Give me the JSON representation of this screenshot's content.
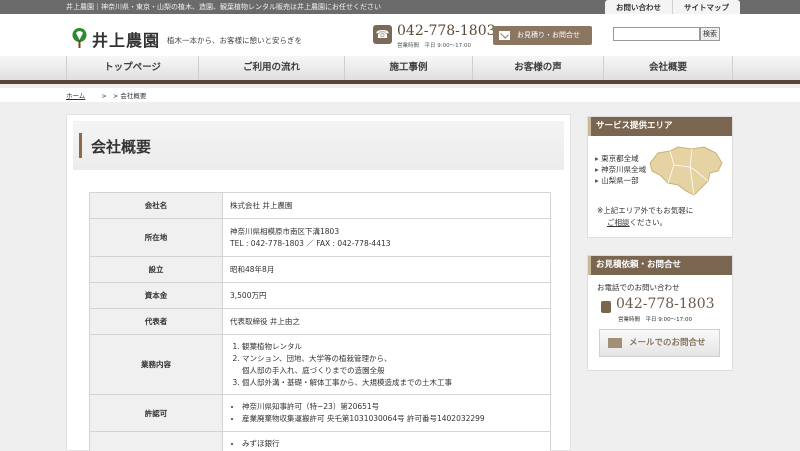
{
  "top_bar": {
    "tagline": "井上農園｜神奈川県・東京・山梨の植木、造園、観葉植物レンタル販売は井上農園にお任せください",
    "links": [
      "お問い合わせ",
      "サイトマップ"
    ]
  },
  "header": {
    "logo_text": "井上農園",
    "catchphrase": "植木一本から、お客様に憩いと安らぎを",
    "phone_icon": "phone-icon",
    "phone": "042-778-1803",
    "hours": "営業時間　平日 9:00～17:00",
    "mail_button": "お見積り・お問合せ",
    "search_placeholder": "",
    "search_button": "検索"
  },
  "nav": {
    "items": [
      "トップページ",
      "ご利用の流れ",
      "施工事例",
      "お客様の声",
      "会社概要"
    ]
  },
  "breadcrumb": {
    "home": "ホーム",
    "separator": ">",
    "current": "> 会社概要"
  },
  "main": {
    "title": "会社概要",
    "rows": [
      {
        "label": "会社名",
        "value": "株式会社 井上農園"
      },
      {
        "label": "所在地",
        "line1": "神奈川県相模原市南区下溝1803",
        "line2": "TEL : 042-778-1803 ／ FAX : 042-778-4413"
      },
      {
        "label": "設立",
        "value": "昭和48年8月"
      },
      {
        "label": "資本金",
        "value": "3,500万円"
      },
      {
        "label": "代表者",
        "value": "代表取締役 井上由之"
      },
      {
        "label": "業務内容",
        "items": [
          "観葉植物レンタル",
          "マンション、団地、大学等の植栽管理から、",
          "個人邸の手入れ、庭づくりまでの造園全般",
          "個人邸外溝・基礎・解体工事から、大規模造成までの土木工事"
        ]
      },
      {
        "label": "許認可",
        "items": [
          "神奈川県知事許可（特−23）第20651号",
          "産業廃棄物収集運搬許可 央乇第1031030064号 許可番号1402032299"
        ]
      },
      {
        "label": "",
        "items": [
          "みずほ銀行"
        ]
      }
    ]
  },
  "sidebar": {
    "service_area": {
      "title": "サービス提供エリア",
      "areas": [
        "東京都全域",
        "神奈川県全域",
        "山梨県一部"
      ],
      "note_prefix": "※上記エリア外でもお気軽に",
      "note_link": "ご相談",
      "note_suffix": "ください。"
    },
    "contact": {
      "title": "お見積依頼・お問合せ",
      "intro": "お電話でのお問い合わせ",
      "phone": "042-778-1803",
      "hours": "営業時間　平日 9:00～17:00",
      "mail_button": "メールでのお問合せ"
    }
  },
  "colors": {
    "brand_brown": "#7a6550",
    "nav_border": "#5a4636",
    "top_strip": "#6b6b6b"
  }
}
